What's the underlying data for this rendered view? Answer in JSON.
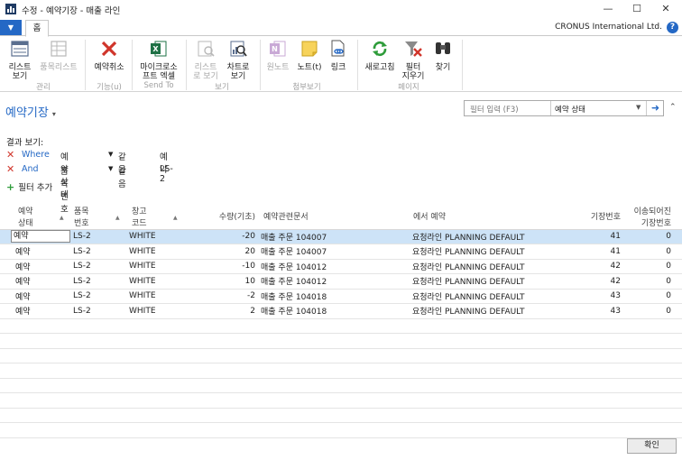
{
  "window": {
    "title": "수정 - 예약기장 - 매출 라인",
    "minimize": "—",
    "maximize": "☐",
    "close": "✕"
  },
  "ribbon": {
    "menu_glyph": "▼",
    "tab_home": "홈",
    "company": "CRONUS International Ltd.",
    "help": "?",
    "buttons": {
      "list_view": "리스트\n보기",
      "item_list": "품목리스트",
      "cancel_reservation": "예약취소",
      "excel": "마이크로소\n프트 엑셀",
      "list_report": "리스트\n로 보기",
      "chart": "차트로\n보기",
      "onenote": "원노트",
      "note": "노트(t)",
      "link": "링크",
      "refresh": "새로고침",
      "clear_filter": "필터\n지우기",
      "find": "찾기"
    },
    "groups": {
      "manage": "관리",
      "function": "기능(u)",
      "send_to": "Send To",
      "view": "보기",
      "attachments": "첨부보기",
      "page": "페이지"
    }
  },
  "page": {
    "title": "예약기장",
    "title_caret": "▾",
    "filter_input_placeholder": "필터 입력 (F3)",
    "filter_field": "예약 상태",
    "filter_dd": "▼",
    "filter_go": "➜",
    "collapse": "⌃"
  },
  "filters": {
    "show_label": "결과 보기:",
    "rows": [
      {
        "keyword": "Where",
        "field": "예약 상태",
        "op": "같음",
        "value": "예약"
      },
      {
        "keyword": "And",
        "field": "품목 번호",
        "op": "같음",
        "value": "LS-2"
      }
    ],
    "add_label": "필터 추가"
  },
  "table": {
    "columns": [
      "예약\n상태",
      "품목\n번호",
      "창고\n코드",
      "수량(기초)",
      "예약관련문서",
      "에서 예약",
      "기장번호",
      "이송되어진\n기장번호"
    ],
    "rows": [
      [
        "예약",
        "LS-2",
        "WHITE",
        "-20",
        "매출 주문 104007",
        "요청라인 PLANNING DEFAULT",
        "41",
        "0"
      ],
      [
        "예약",
        "LS-2",
        "WHITE",
        "20",
        "매출 주문 104007",
        "요청라인 PLANNING DEFAULT",
        "41",
        "0"
      ],
      [
        "예약",
        "LS-2",
        "WHITE",
        "-10",
        "매출 주문 104012",
        "요청라인 PLANNING DEFAULT",
        "42",
        "0"
      ],
      [
        "예약",
        "LS-2",
        "WHITE",
        "10",
        "매출 주문 104012",
        "요청라인 PLANNING DEFAULT",
        "42",
        "0"
      ],
      [
        "예약",
        "LS-2",
        "WHITE",
        "-2",
        "매출 주문 104018",
        "요청라인 PLANNING DEFAULT",
        "43",
        "0"
      ],
      [
        "예약",
        "LS-2",
        "WHITE",
        "2",
        "매출 주문 104018",
        "요청라인 PLANNING DEFAULT",
        "43",
        "0"
      ]
    ]
  },
  "footer": {
    "ok_label": "확인"
  },
  "colors": {
    "accent": "#2468c5",
    "selected_row": "#cde3f7",
    "delete": "#d0352b"
  }
}
